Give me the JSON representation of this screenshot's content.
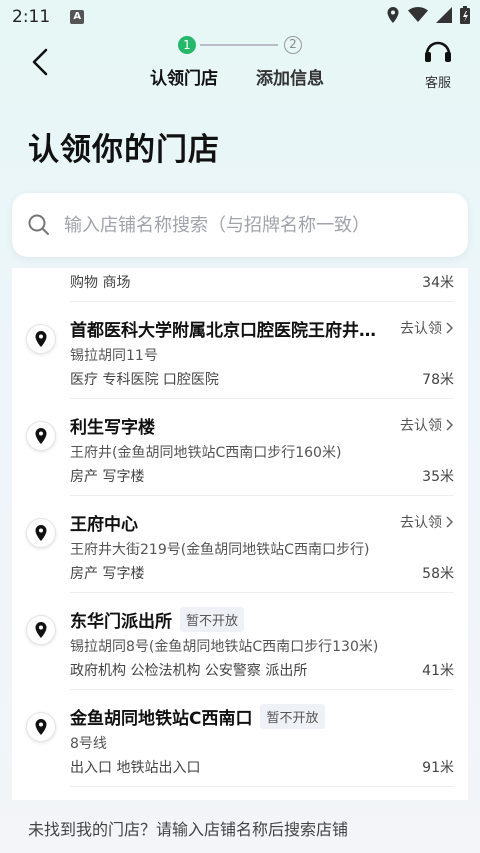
{
  "status": {
    "time": "2:11",
    "notif": "A"
  },
  "nav": {
    "step1_num": "1",
    "step1_label": "认领门店",
    "step2_num": "2",
    "step2_label": "添加信息",
    "service_label": "客服"
  },
  "page_title": "认领你的门店",
  "search": {
    "placeholder": "输入店铺名称搜索（与招牌名称一致）"
  },
  "partial_item": {
    "tags": "购物 商场",
    "distance": "34米"
  },
  "items": [
    {
      "name": "首都医科大学附属北京口腔医院王府井院区",
      "address": "锡拉胡同11号",
      "tags": "医疗 专科医院 口腔医院",
      "distance": "78米",
      "action": "去认领",
      "badge": ""
    },
    {
      "name": "利生写字楼",
      "address": "王府井(金鱼胡同地铁站C西南口步行160米)",
      "tags": "房产 写字楼",
      "distance": "35米",
      "action": "去认领",
      "badge": ""
    },
    {
      "name": "王府中心",
      "address": "王府井大街219号(金鱼胡同地铁站C西南口步行)",
      "tags": "房产 写字楼",
      "distance": "58米",
      "action": "去认领",
      "badge": ""
    },
    {
      "name": "东华门派出所",
      "address": "锡拉胡同8号(金鱼胡同地铁站C西南口步行130米)",
      "tags": "政府机构 公检法机构 公安警察 派出所",
      "distance": "41米",
      "action": "",
      "badge": "暂不开放"
    },
    {
      "name": "金鱼胡同地铁站C西南口",
      "address": "8号线",
      "tags": "出入口 地铁站出入口",
      "distance": "91米",
      "action": "",
      "badge": "暂不开放"
    }
  ],
  "footer": "未找到我的门店？请输入店铺名称后搜索店铺",
  "colors": {
    "accent": "#25b86a",
    "text": "#111111",
    "muted": "#555555"
  }
}
